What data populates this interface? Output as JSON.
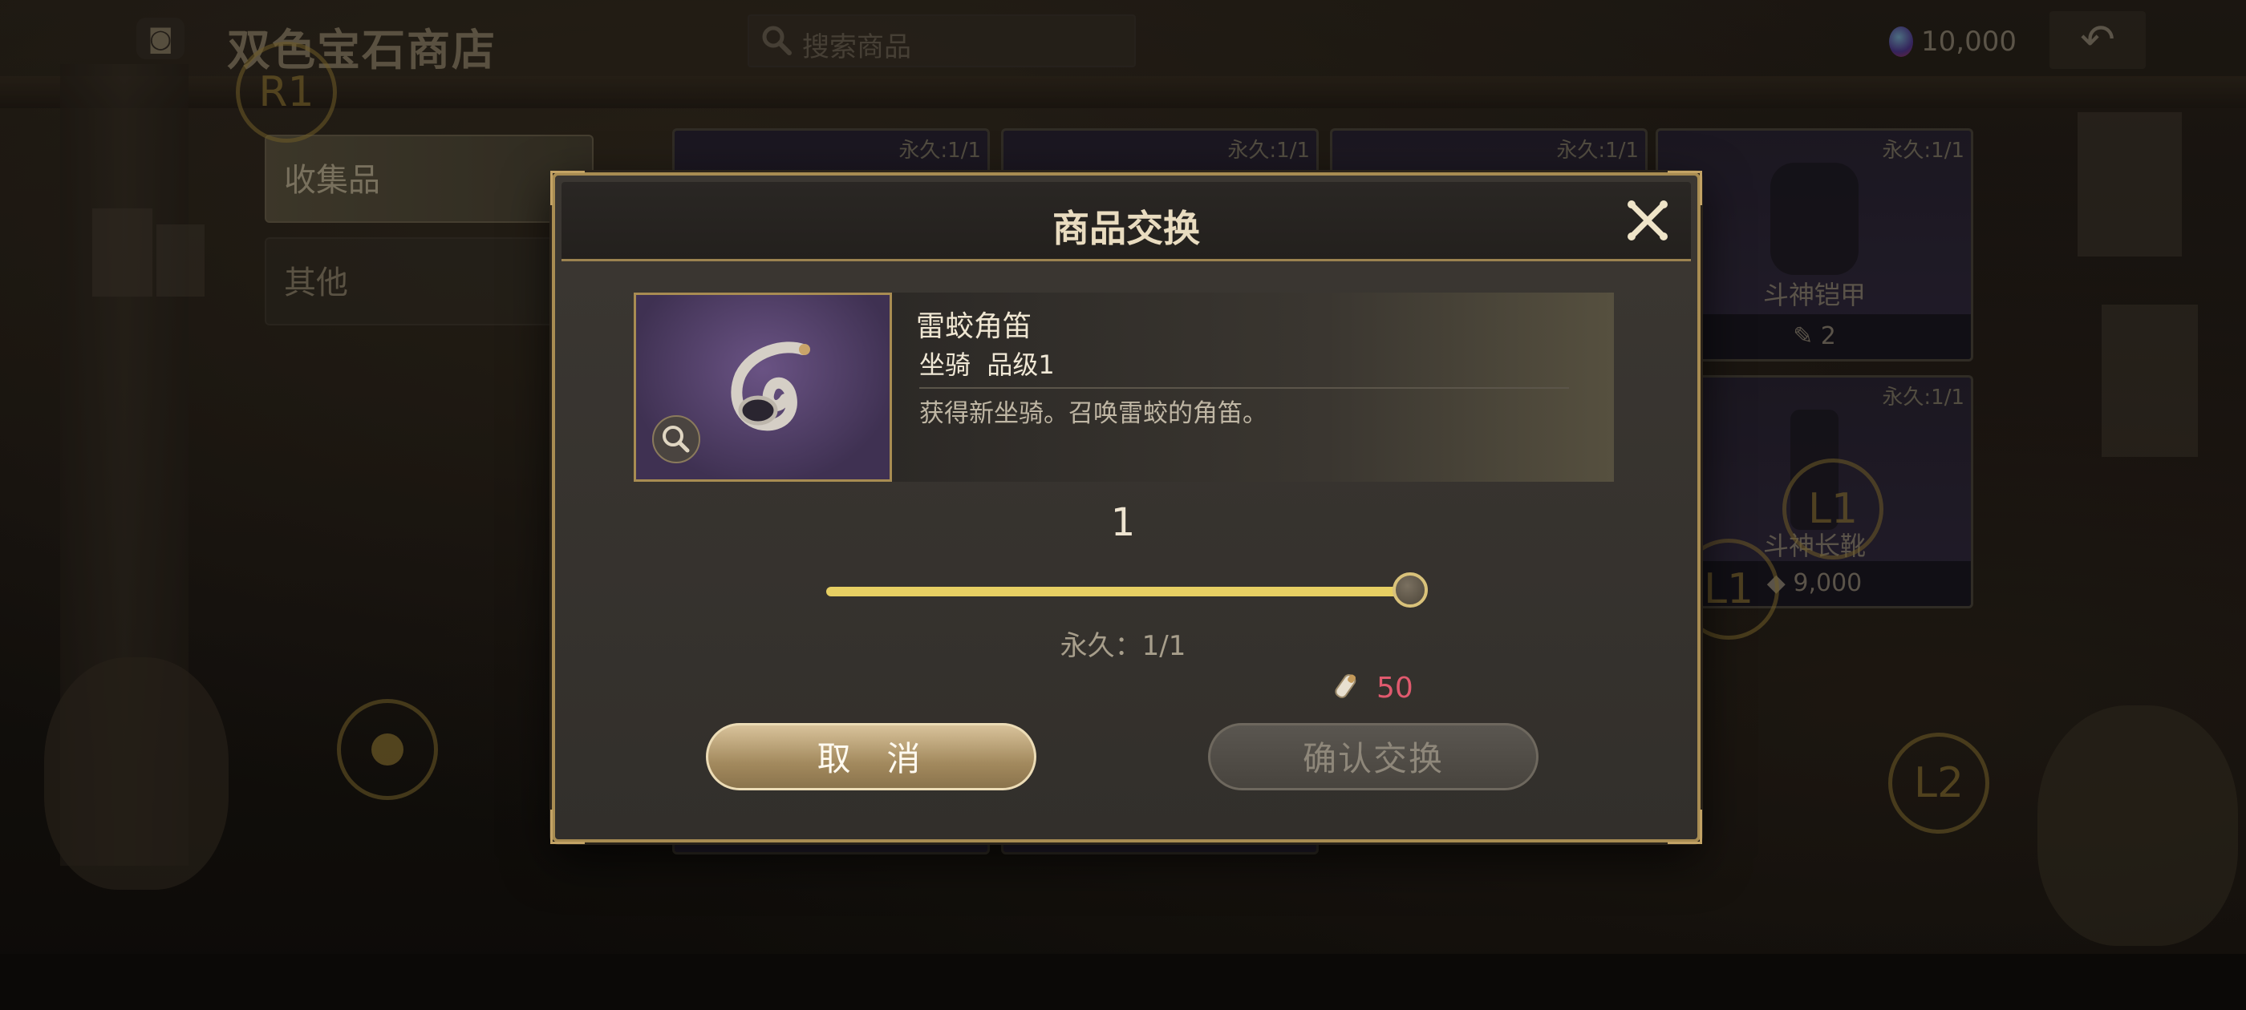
{
  "header": {
    "shop_title": "双色宝石商店",
    "search_placeholder": "搜索商品",
    "currency_amount": "10,000",
    "back_icon": "undo-arrow-icon"
  },
  "sidebar": {
    "items": [
      {
        "label": "收集品",
        "active": true
      },
      {
        "label": "其他",
        "active": false
      }
    ]
  },
  "grid": {
    "cards": [
      {
        "limit": "永久:1/1"
      },
      {
        "limit": "永久:1/1"
      },
      {
        "limit": "永久:1/1"
      },
      {
        "limit": "永久:1/1",
        "name": "斗神铠甲",
        "price": "2"
      },
      {
        "limit": "永久:1/1",
        "name": "斗神长靴",
        "price": "9,000"
      }
    ]
  },
  "controller_hints": {
    "r1": "R1",
    "l1_a": "L1",
    "l1_b": "L1",
    "l2": "L2"
  },
  "modal": {
    "title": "商品交换",
    "item_name": "雷蛟角笛",
    "item_type": "坐骑  品级1",
    "item_description": "获得新坐骑。召唤雷蛟的角笛。",
    "quantity": "1",
    "slider_fraction": 1.0,
    "limit_text": "永久：1/1",
    "cost_amount": "50",
    "cancel_label": "取  消",
    "confirm_label": "确认交换"
  },
  "colors": {
    "accent_gold": "#a88c52",
    "slider_fill": "#e7cf63",
    "cost_red": "#e05a6e"
  }
}
